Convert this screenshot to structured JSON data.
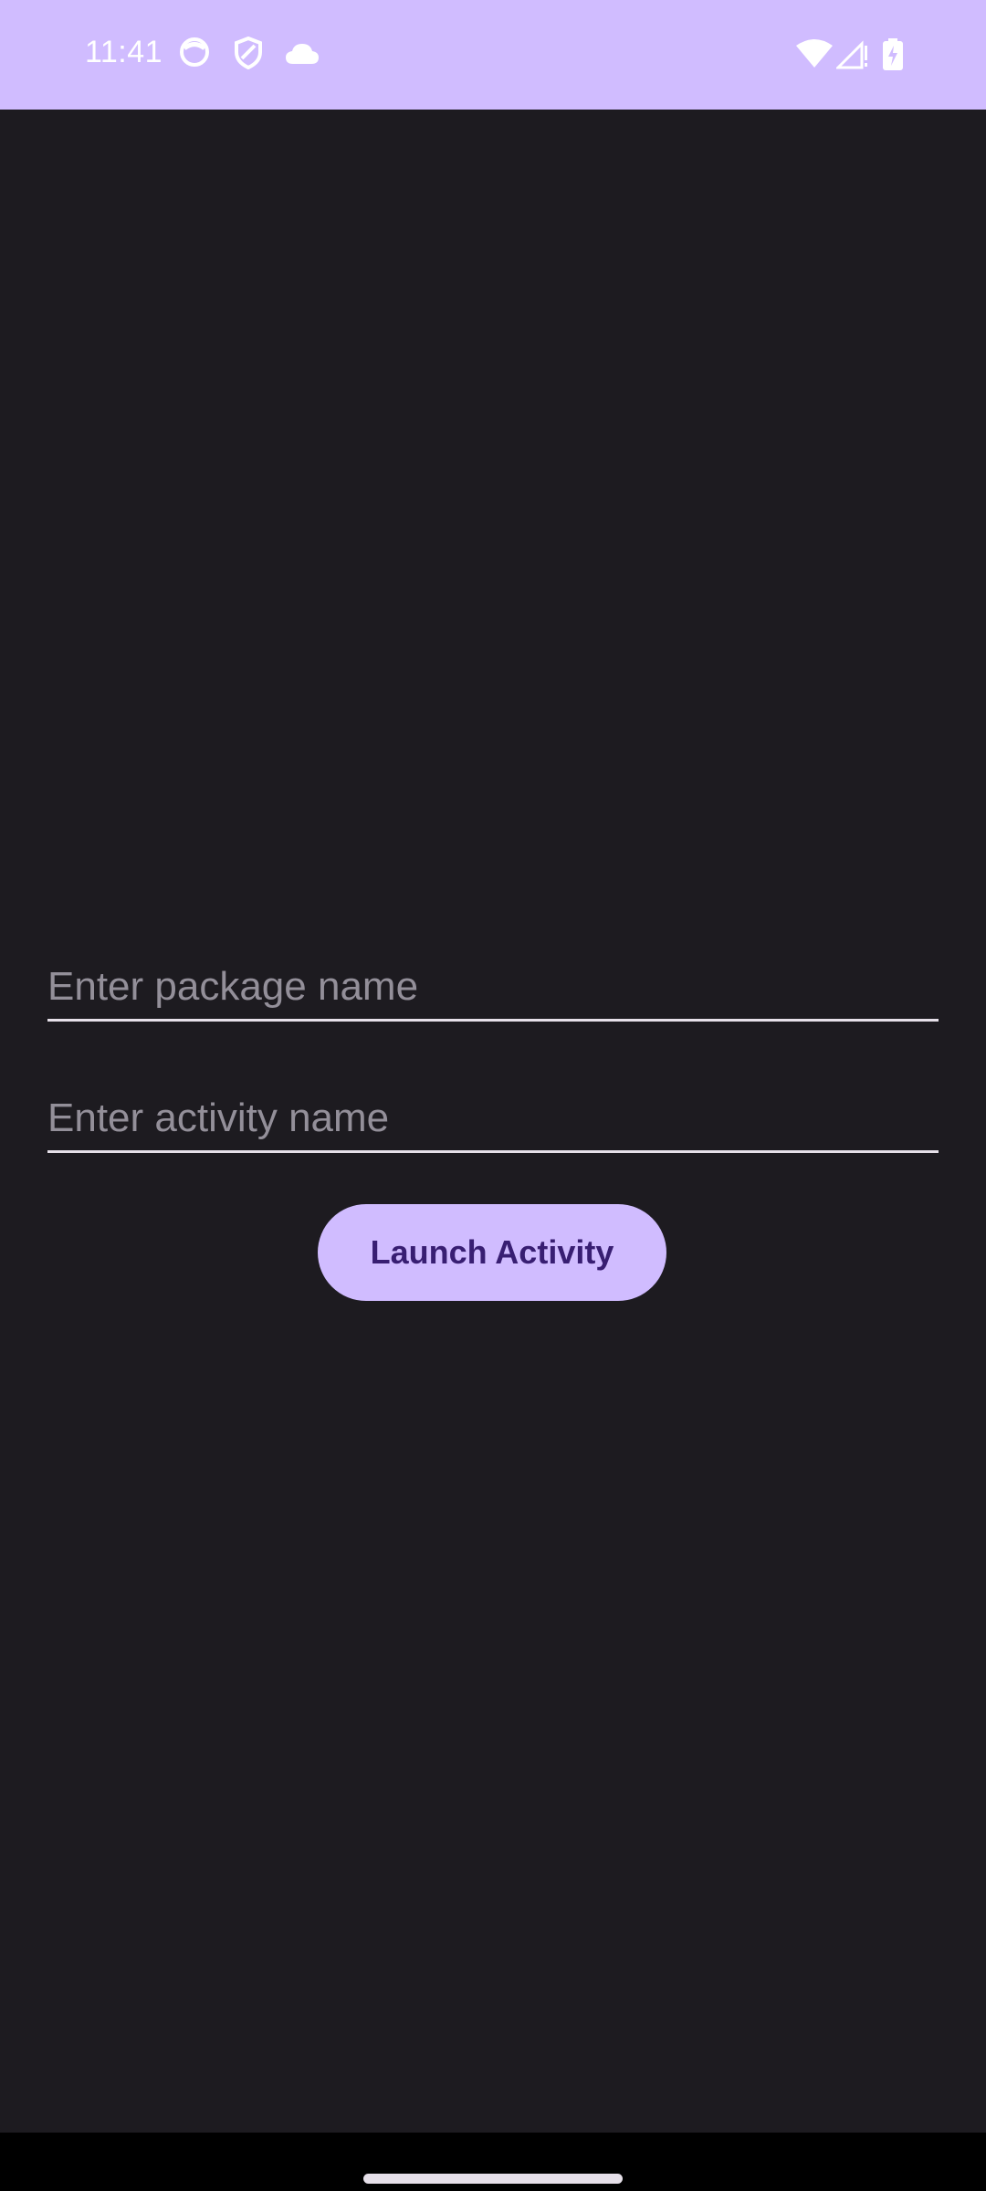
{
  "status_bar": {
    "time": "11:41",
    "icons_left": [
      "face-icon",
      "shield-icon",
      "cloud-icon"
    ],
    "icons_right": [
      "wifi-icon",
      "signal-icon",
      "battery-charging-icon"
    ],
    "color": "#d0bcff"
  },
  "form": {
    "package_placeholder": "Enter package name",
    "package_value": "",
    "activity_placeholder": "Enter activity name",
    "activity_value": "",
    "launch_label": "Launch Activity"
  },
  "colors": {
    "background": "#1d1b20",
    "accent": "#d0bcff",
    "button_text": "#381e72",
    "placeholder": "#938f99"
  }
}
